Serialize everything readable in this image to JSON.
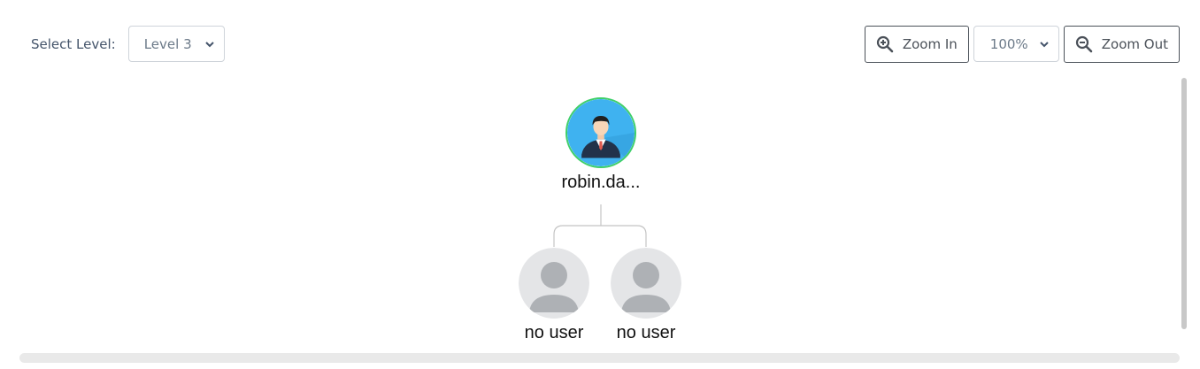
{
  "toolbar": {
    "select_level_label": "Select Level:",
    "level_value": "Level 3",
    "zoom_in_label": "Zoom In",
    "zoom_value": "100%",
    "zoom_out_label": "Zoom Out"
  },
  "tree": {
    "root": {
      "label": "robin.da...",
      "avatar": "businessman-avatar",
      "border_color": "#3ecf6a",
      "bg_color": "#3fb2f0"
    },
    "children": [
      {
        "label": "no user",
        "avatar": "default-user-avatar"
      },
      {
        "label": "no user",
        "avatar": "default-user-avatar"
      }
    ]
  }
}
